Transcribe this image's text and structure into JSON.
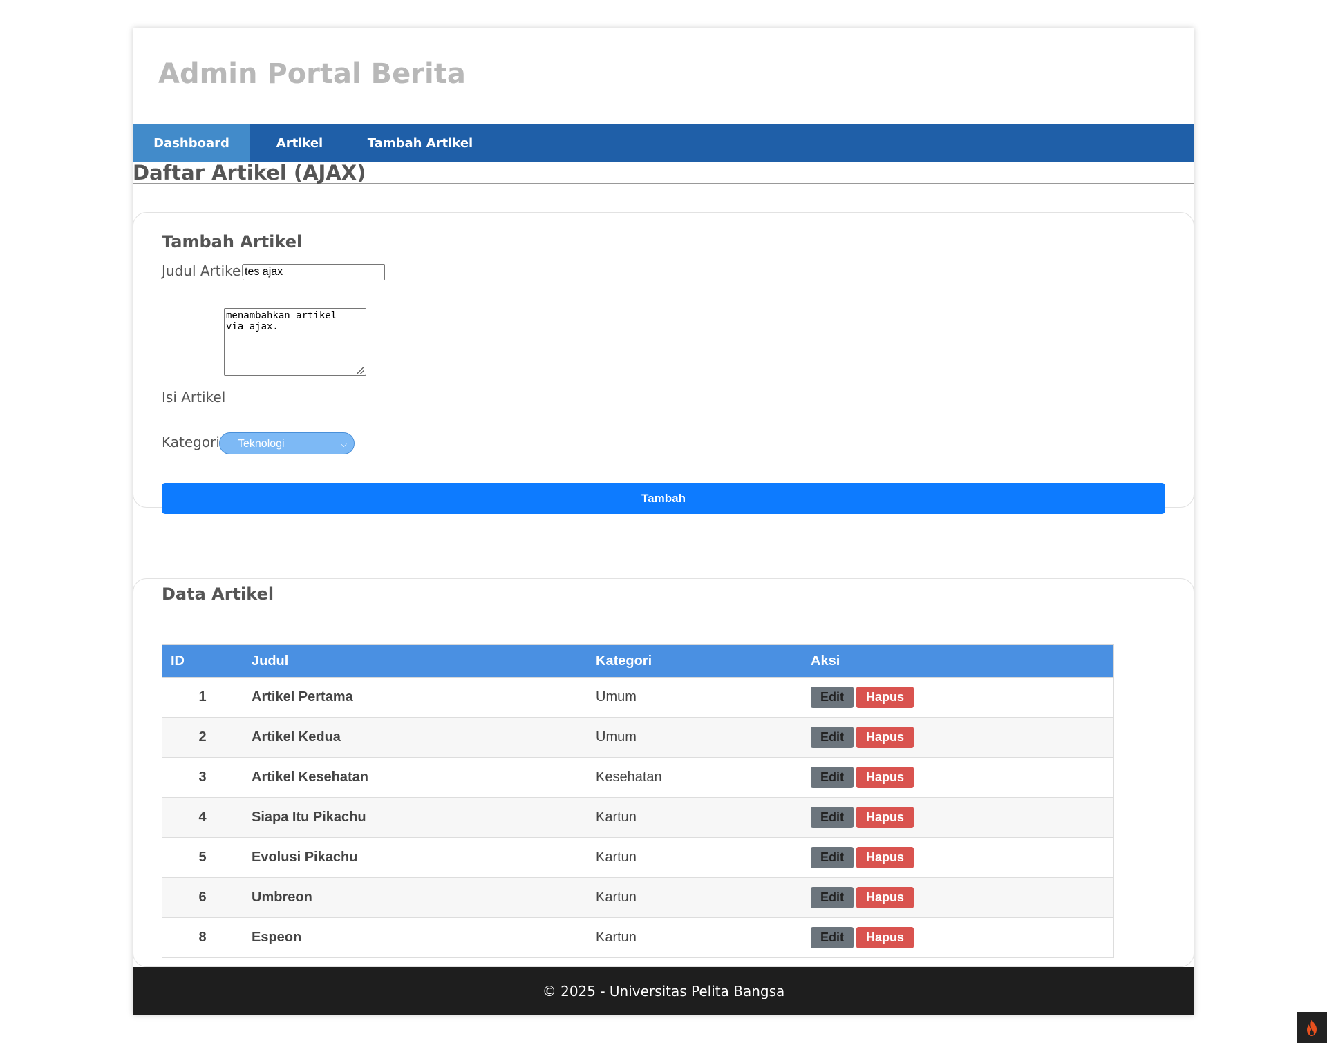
{
  "site": {
    "title": "Admin Portal Berita"
  },
  "nav": {
    "items": [
      {
        "label": "Dashboard"
      },
      {
        "label": "Artikel"
      },
      {
        "label": "Tambah Artikel"
      }
    ],
    "active": "Dashboard"
  },
  "page": {
    "heading": "Daftar Artikel (AJAX)"
  },
  "form": {
    "title": "Tambah Artikel",
    "judul_label": "Judul Artikel",
    "judul_value": "tes ajax",
    "isi_label": "Isi Artikel",
    "isi_value": "menambahkan artikel\nvia ajax.",
    "kategori_label": "Kategori",
    "kategori_selected": "Teknologi",
    "submit_label": "Tambah"
  },
  "data_section": {
    "title": "Data Artikel",
    "columns": [
      "ID",
      "Judul",
      "Kategori",
      "Aksi"
    ],
    "rows": [
      {
        "id": "1",
        "judul": "Artikel Pertama",
        "kategori": "Umum"
      },
      {
        "id": "2",
        "judul": "Artikel Kedua",
        "kategori": "Umum"
      },
      {
        "id": "3",
        "judul": "Artikel Kesehatan",
        "kategori": "Kesehatan"
      },
      {
        "id": "4",
        "judul": "Siapa Itu Pikachu",
        "kategori": "Kartun"
      },
      {
        "id": "5",
        "judul": "Evolusi Pikachu",
        "kategori": "Kartun"
      },
      {
        "id": "6",
        "judul": "Umbreon",
        "kategori": "Kartun"
      },
      {
        "id": "8",
        "judul": "Espeon",
        "kategori": "Kartun"
      }
    ],
    "edit_label": "Edit",
    "hapus_label": "Hapus"
  },
  "footer": {
    "text": "© 2025 - Universitas Pelita Bangsa"
  },
  "colors": {
    "nav_bg": "#1f5fa8",
    "nav_active": "#428bca",
    "primary_button": "#0d7bff",
    "table_header": "#4a90e2",
    "edit_button": "#6c757d",
    "hapus_button": "#d9534f",
    "footer_bg": "#1e1e1e"
  },
  "icons": {
    "corner_badge": "flame-icon",
    "select_arrow": "chevron-down-icon",
    "textarea_grip": "resize-grip-icon"
  }
}
